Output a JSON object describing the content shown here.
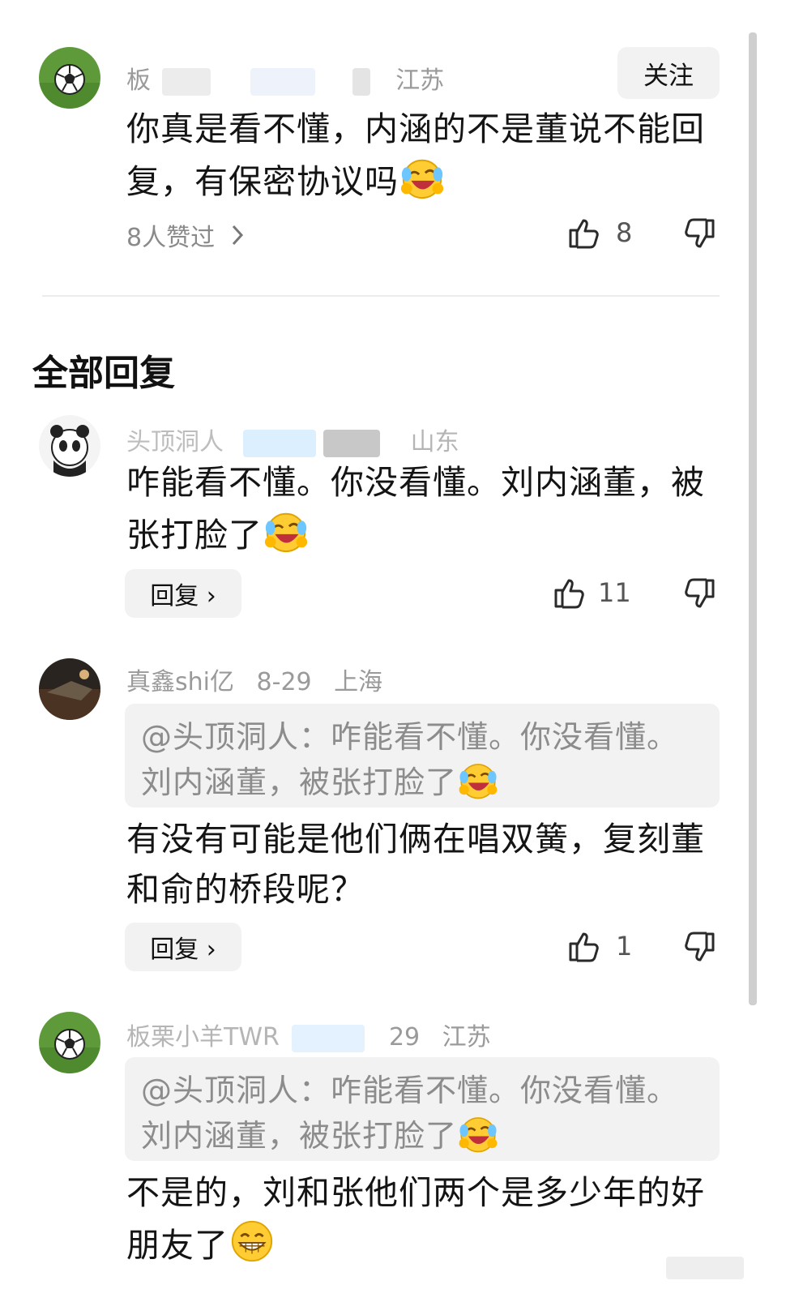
{
  "original_comment": {
    "user_visible": "板",
    "location": "江苏",
    "follow_label": "关注",
    "text": "你真是看不懂，内涵的不是董说不能回复，有保密协议吗",
    "liked_by": "8人赞过",
    "like_count": "8"
  },
  "section_title": "全部回复",
  "replies": [
    {
      "user_visible": "头顶洞人",
      "location": "山东",
      "text_line1": "咋能看不懂。你没看懂。刘内涵董，被",
      "text_line2": "张打脸了",
      "reply_label": "回复 ›",
      "like_count": "11"
    },
    {
      "user_visible": "真鑫shi亿",
      "date": "8-29",
      "location": "上海",
      "quote_line1": "@头顶洞人：咋能看不懂。你没看懂。",
      "quote_line2": "刘内涵董，被张打脸了",
      "text_line1": "有没有可能是他们俩在唱双簧，复刻董",
      "text_line2": "和俞的桥段呢？",
      "reply_label": "回复 ›",
      "like_count": "1"
    },
    {
      "user_visible": "板栗小羊TWR",
      "date": "29",
      "location": "江苏",
      "quote_line1": "@头顶洞人：咋能看不懂。你没看懂。",
      "quote_line2": "刘内涵董，被张打脸了",
      "text_line1": "不是的，刘和张他们两个是多少年的好",
      "text_line2": "朋友了"
    }
  ],
  "colors": {
    "text": "#141414",
    "meta": "#9a9a9a",
    "pill_bg": "#f2f2f2",
    "quote_text": "#8c8c8c",
    "divider": "#ececec"
  },
  "icons": [
    "soccer-ball-avatar",
    "panda-avatar",
    "night-photo-avatar",
    "thumbs-up-icon",
    "thumbs-down-icon",
    "chevron-right-icon",
    "laughing-crying-emoji",
    "grinning-emoji"
  ]
}
